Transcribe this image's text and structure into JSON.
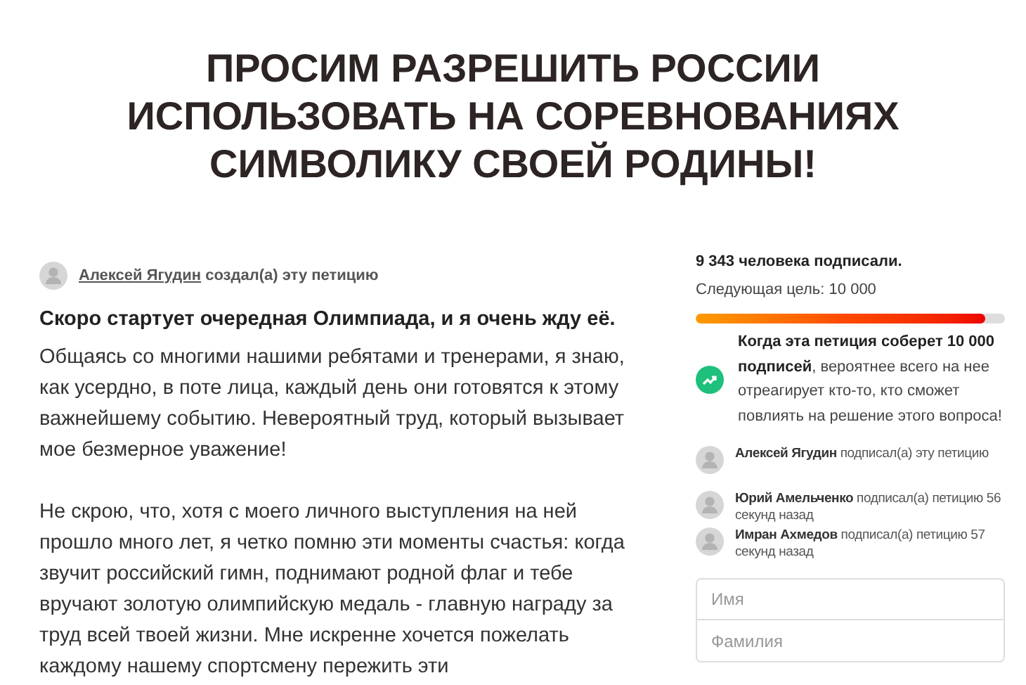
{
  "title": "ПРОСИМ РАЗРЕШИТЬ РОССИИ ИСПОЛЬЗОВАТЬ НА СОРЕВНОВАНИЯХ СИМВОЛИКУ СВОЕЙ РОДИНЫ!",
  "author": {
    "name": "Алексей Ягудин",
    "action": "создал(а) эту петицию"
  },
  "body": {
    "lead": "Скоро стартует очередная Олимпиада, и я очень жду её.",
    "paragraphs": [
      "Общаясь со многими нашими ребятами и тренерами, я знаю, как усердно, в поте лица, каждый день они готовятся к этому важнейшему событию. Невероятный труд, который вызывает мое безмерное уважение!",
      "Не скрою, что, хотя с моего личного выступления на ней прошло много лет, я четко помню эти моменты счастья: когда звучит российский гимн, поднимают родной флаг и тебе вручают золотую олимпийскую медаль - главную награду за труд всей твоей жизни. Мне искренне хочется пожелать каждому нашему спортсмену пережить эти"
    ]
  },
  "sidebar": {
    "count": "9 343 человека подписали.",
    "goal": "Следующая цель: 10 000",
    "progress": {
      "level": 0.9343
    },
    "tip": "**Когда эта петиция соберет 10 000 подписей**, вероятнее всего на нее отреагирует кто-то, кто сможет повлиять на решение этого вопроса!",
    "signers": [
      {
        "name": "Алексей Ягудин",
        "text": "подписал(а) эту петицию"
      },
      {
        "name": "Юрий Амельченко",
        "text": "подписал(а) петицию 56 секунд назад"
      },
      {
        "name": "Имран Ахмедов",
        "text": "подписал(а) петицию 57 секунд назад"
      }
    ],
    "form": [
      {
        "placeholder": "Имя"
      },
      {
        "placeholder": "Фамилия"
      }
    ]
  }
}
